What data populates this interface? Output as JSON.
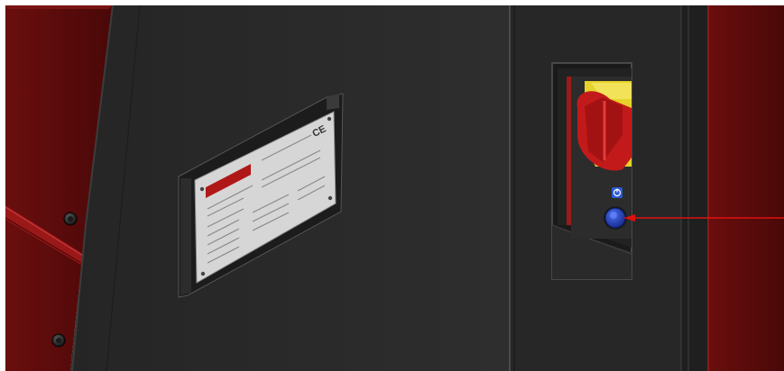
{
  "colors": {
    "machine_body": "#2b2b2b",
    "side_panel_red": "#5e0c0c",
    "accent_red": "#c21a1a",
    "switch_yellow": "#e6d22a",
    "button_blue": "#1d3fb3",
    "pointer_line": "#e01010",
    "nameplate": "#d9d9d9"
  },
  "nameplate": {
    "ce_mark": "CE"
  },
  "icons": {
    "power_symbol": "power-icon",
    "main_switch": "rotary-switch-icon",
    "reset_button": "push-button-icon"
  }
}
